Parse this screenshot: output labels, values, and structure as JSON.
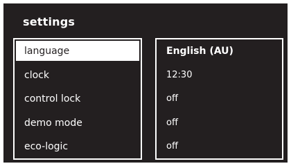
{
  "title": "settings",
  "menu": {
    "items": [
      {
        "label": "language"
      },
      {
        "label": "clock"
      },
      {
        "label": "control lock"
      },
      {
        "label": "demo mode"
      },
      {
        "label": "eco-logic"
      }
    ]
  },
  "values": {
    "items": [
      {
        "value": "English (AU)"
      },
      {
        "value": "12:30"
      },
      {
        "value": "off"
      },
      {
        "value": "off"
      },
      {
        "value": "off"
      }
    ]
  },
  "colors": {
    "background": "#231f20",
    "foreground": "#ffffff",
    "selected_bg": "#ffffff",
    "selected_text": "#231f20"
  }
}
